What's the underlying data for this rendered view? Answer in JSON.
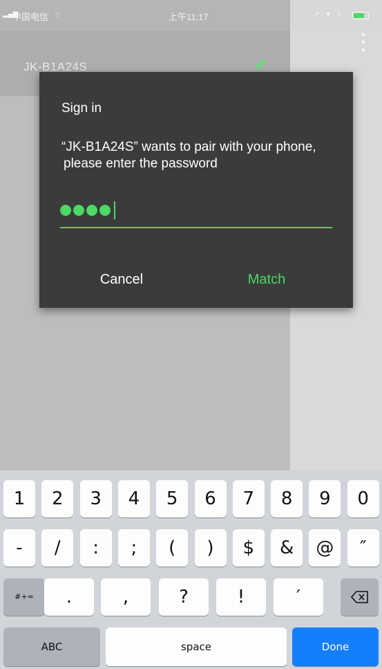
{
  "status_bar": {
    "carrier": "中国电信",
    "time": "上午11:17"
  },
  "background": {
    "device_title": "JK-B1A24S"
  },
  "dialog": {
    "title": "Sign in",
    "message_line1": "“JK-B1A24S” wants to pair with your phone,",
    "message_line2": "please enter the password",
    "password_dot_count": 4,
    "cancel_label": "Cancel",
    "match_label": "Match",
    "accent_color": "#4cd964"
  },
  "keyboard": {
    "row1": [
      "1",
      "2",
      "3",
      "4",
      "5",
      "6",
      "7",
      "8",
      "9",
      "0"
    ],
    "row2": [
      "-",
      "/",
      ":",
      ";",
      "(",
      ")",
      "$",
      "&",
      "@",
      "″"
    ],
    "row3_toggle": "#+=",
    "row3": [
      ".",
      ",",
      "?",
      "!",
      "′"
    ],
    "abc_label": "ABC",
    "space_label": "space",
    "done_label": "Done",
    "done_color": "#147efb"
  }
}
